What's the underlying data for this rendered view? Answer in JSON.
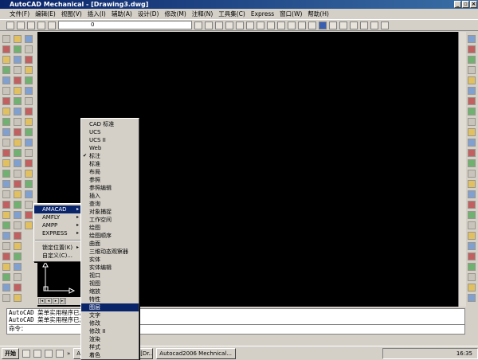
{
  "window": {
    "title": "AutoCAD Mechanical - [Drawing3.dwg]",
    "min": "_",
    "max": "▫",
    "close": "×"
  },
  "menubar": [
    "文件(F)",
    "编辑(E)",
    "视图(V)",
    "插入(I)",
    "辅助(A)",
    "设计(D)",
    "修改(M)",
    "注释(N)",
    "工具集(C)",
    "Express",
    "窗口(W)",
    "帮助(H)"
  ],
  "toolbar": {
    "layer_value": "0"
  },
  "context_menu": {
    "items": [
      {
        "label": "AMACAD",
        "submenu": true,
        "selected": true
      },
      {
        "label": "AMFLY",
        "submenu": true
      },
      {
        "label": "AMPP",
        "submenu": true
      },
      {
        "label": "EXPRESS",
        "submenu": true
      }
    ],
    "items2": [
      {
        "label": "锁定位置(K)",
        "submenu": true
      },
      {
        "label": "自定义(C)..."
      }
    ]
  },
  "submenu": {
    "items": [
      "CAD 标准",
      "UCS",
      "UCS II",
      "Web",
      "标注",
      "标准",
      "布局",
      "参照",
      "参照编辑",
      "插入",
      "查询",
      "对象捕捉",
      "工作空间",
      "绘图",
      "绘图顺序",
      "曲面",
      "三维动态观察器",
      "实体",
      "实体编辑",
      "视口",
      "视图",
      "缩放",
      "特性",
      "图层",
      "文字",
      "修改",
      "修改 II",
      "渲染",
      "样式",
      "着色"
    ],
    "checked": "标注",
    "selected": "图层"
  },
  "command": {
    "lines": [
      "AutoCAD 菜单实用程序已加载。",
      "AutoCAD 菜单实用程序已加载。"
    ],
    "prompt": "命令："
  },
  "taskbar": {
    "start": "开始",
    "more": "»",
    "tasks": [
      "AutoCAD Mechanical - [Dr...",
      "Autocad2006 Mechnical..."
    ],
    "clock": "16:35"
  },
  "tabs": [
    "|◂",
    "◂",
    "▸",
    "▸|"
  ]
}
